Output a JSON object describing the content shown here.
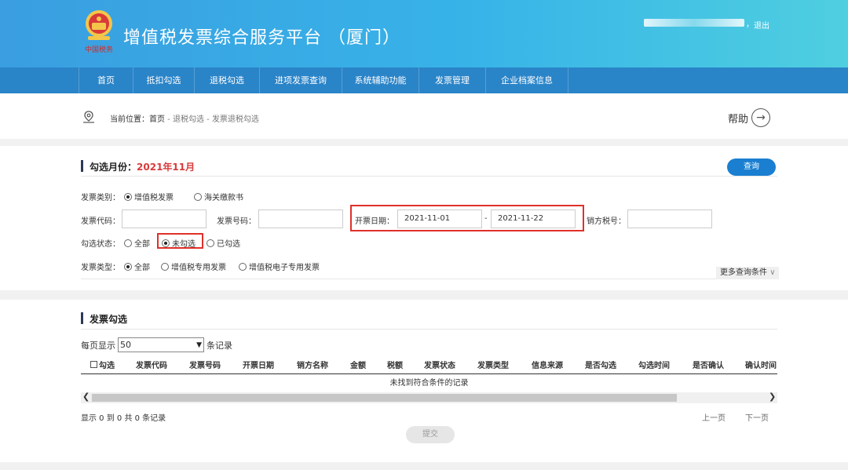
{
  "header": {
    "title": "增值税发票综合服务平台 （厦门）",
    "logo_text": "中国税务",
    "user_separator": "，",
    "logout_label": "退出"
  },
  "nav": {
    "items": [
      {
        "label": "首页"
      },
      {
        "label": "抵扣勾选"
      },
      {
        "label": "退税勾选"
      },
      {
        "label": "进项发票查询"
      },
      {
        "label": "系统辅助功能"
      },
      {
        "label": "发票管理"
      },
      {
        "label": "企业档案信息"
      }
    ]
  },
  "breadcrumb": {
    "prefix": "当前位置：",
    "home": "首页",
    "sep": " - ",
    "level1": "退税勾选",
    "level2": "发票退税勾选"
  },
  "help_label": "帮助",
  "query_section": {
    "title_prefix": "勾选月份：",
    "month": "2021年11月",
    "query_button": "查询",
    "invoice_category": {
      "label": "发票类别：",
      "options": [
        {
          "label": "增值税发票",
          "selected": true
        },
        {
          "label": "海关缴款书",
          "selected": false
        }
      ]
    },
    "invoice_code_label": "发票代码：",
    "invoice_code_value": "",
    "invoice_number_label": "发票号码：",
    "invoice_number_value": "",
    "issue_date_label": "开票日期：",
    "date_from": "2021-11-01",
    "date_sep": "-",
    "date_to": "2021-11-22",
    "seller_tax_label": "销方税号：",
    "seller_tax_value": "",
    "select_status": {
      "label": "勾选状态：",
      "options": [
        {
          "label": "全部",
          "selected": false
        },
        {
          "label": "未勾选",
          "selected": true
        },
        {
          "label": "已勾选",
          "selected": false
        }
      ]
    },
    "invoice_type": {
      "label": "发票类型：",
      "options": [
        {
          "label": "全部",
          "selected": true
        },
        {
          "label": "增值税专用发票",
          "selected": false
        },
        {
          "label": "增值税电子专用发票",
          "selected": false
        }
      ]
    },
    "more_conditions": "更多查询条件"
  },
  "result_section": {
    "title": "发票勾选",
    "per_page_prefix": "每页显示",
    "per_page_value": "50",
    "per_page_suffix": "条记录",
    "columns": [
      "勾选",
      "发票代码",
      "发票号码",
      "开票日期",
      "销方名称",
      "金额",
      "税额",
      "发票状态",
      "发票类型",
      "信息来源",
      "是否勾选",
      "勾选时间",
      "是否确认",
      "确认时间"
    ],
    "empty_message": "未找到符合条件的记录",
    "pager_info": "显示 0 到 0 共 0 条记录",
    "prev_page": "上一页",
    "next_page": "下一页",
    "submit": "提交"
  },
  "colors": {
    "header_gradient_start": "#3a9ee0",
    "header_gradient_end": "#4fcfe0",
    "nav_bg": "#2a84c8",
    "accent": "#1a7fd1",
    "highlight_red": "#e0302a",
    "month_red": "#d93a3a"
  }
}
